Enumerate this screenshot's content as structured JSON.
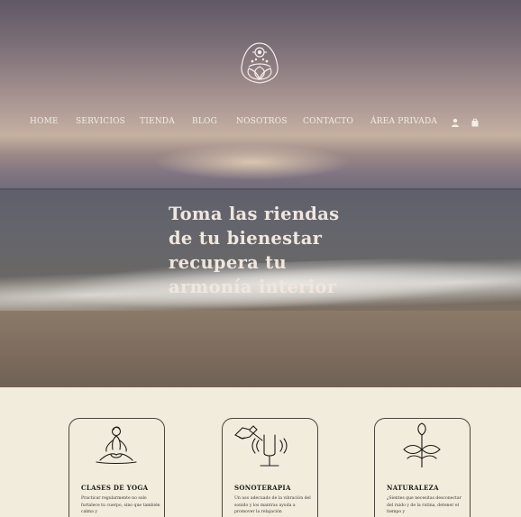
{
  "nav": {
    "items": [
      "HOME",
      "SERVICIOS",
      "TIENDA",
      "BLOG",
      "NOSOTROS",
      "CONTACTO",
      "ÁREA PRIVADA"
    ],
    "icons": [
      "user-icon",
      "cart-icon"
    ]
  },
  "hero": {
    "headline_lines": [
      "Toma las riendas",
      "de tu bienestar",
      "recupera tu",
      "armonía interior"
    ]
  },
  "cards": [
    {
      "title": "CLASES DE YOGA",
      "text": "Practicar regularmente no solo fortalece tu cuerpo, sino que también calma y",
      "icon": "yoga-meditation-icon"
    },
    {
      "title": "SONOTERAPIA",
      "text": "Un uso adecuado de la vibración del sonido y los mantras ayuda a promover la relajación",
      "icon": "tuning-fork-icon"
    },
    {
      "title": "NATURALEZA",
      "text": "¿Sientes que necesitas desconectar del ruido y de la rutina, detener el tiempo y",
      "icon": "sprout-icon"
    }
  ],
  "colors": {
    "background": "#f1ecdc",
    "text_light": "#f3ece6",
    "card_border": "#4b4640"
  }
}
